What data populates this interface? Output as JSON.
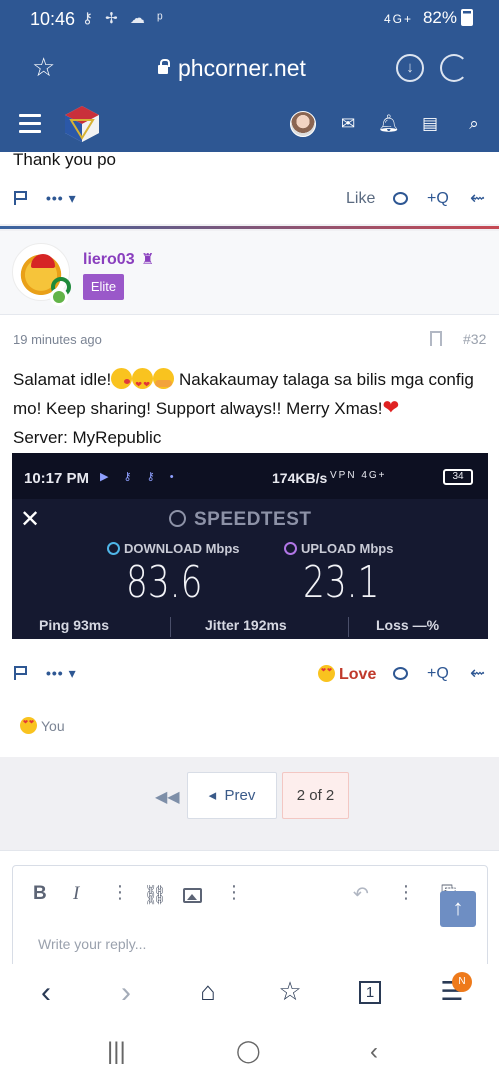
{
  "status": {
    "time": "10:46",
    "battery": "82%",
    "net": "4G+"
  },
  "browser": {
    "url": "phcorner.net"
  },
  "prev_post": {
    "message": "Thank you po",
    "actions": {
      "more": "•••",
      "like": "Like",
      "quote": "+Q"
    }
  },
  "post": {
    "username": "liero03",
    "badge": "Elite",
    "time": "19 minutes ago",
    "number": "#32",
    "text_a": "Salamat idle!",
    "text_b": " Nakakaumay talaga sa bilis mga config mo! Keep sharing! Support always!! Merry Xmas!",
    "text_c": "Server: MyRepublic",
    "actions": {
      "more": "•••",
      "love": "Love",
      "quote": "+Q"
    },
    "reacted_by": "You",
    "screenshot": {
      "time": "10:17 PM",
      "rate": "174KB/s",
      "status_icons": "VPN 4G+",
      "battery": "34",
      "title": "SPEEDTEST",
      "download_label": "DOWNLOAD Mbps",
      "upload_label": "UPLOAD Mbps",
      "download": "83.6",
      "upload": "23.1",
      "ping": "Ping 93ms",
      "jitter": "Jitter 192ms",
      "loss": "Loss —%"
    }
  },
  "pagination": {
    "prev": "Prev",
    "current": "2 of 2"
  },
  "editor": {
    "bold": "B",
    "italic": "I",
    "placeholder": "Write your reply..."
  },
  "bottom_nav": {
    "tabs_count": "1",
    "notif": "N"
  }
}
